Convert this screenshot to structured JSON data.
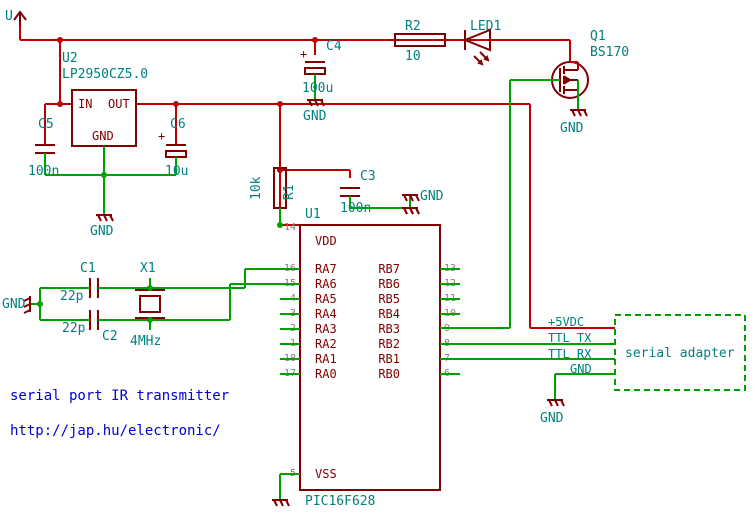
{
  "title": "serial port IR transmitter",
  "url": "http://jap.hu/electronic/",
  "power_label": "U",
  "regulator": {
    "ref": "U2",
    "part": "LP2950CZ5.0",
    "in": "IN",
    "out": "OUT",
    "gnd": "GND"
  },
  "caps": {
    "C1": {
      "ref": "C1",
      "val": "22p"
    },
    "C2": {
      "ref": "C2",
      "val": "22p"
    },
    "C3": {
      "ref": "C3",
      "val": "100n"
    },
    "C4": {
      "ref": "C4",
      "val": "100u"
    },
    "C5": {
      "ref": "C5",
      "val": "100n"
    },
    "C6": {
      "ref": "C6",
      "val": "10u"
    }
  },
  "res": {
    "R1": {
      "ref": "R1",
      "val": "10k"
    },
    "R2": {
      "ref": "R2",
      "val": "10"
    }
  },
  "crystal": {
    "ref": "X1",
    "val": "4MHz"
  },
  "led": {
    "ref": "LED1"
  },
  "mosfet": {
    "ref": "Q1",
    "part": "BS170"
  },
  "mcu": {
    "ref": "U1",
    "part": "PIC16F628",
    "vdd": "VDD",
    "vss": "VSS",
    "left_pins": [
      [
        "14",
        "VDD"
      ],
      [
        "16",
        "RA7"
      ],
      [
        "15",
        "RA6"
      ],
      [
        "4",
        "RA5"
      ],
      [
        "3",
        "RA4"
      ],
      [
        "2",
        "RA3"
      ],
      [
        "1",
        "RA2"
      ],
      [
        "18",
        "RA1"
      ],
      [
        "17",
        "RA0"
      ],
      [
        "5",
        "VSS"
      ]
    ],
    "right_pins": [
      [
        "13",
        "RB7"
      ],
      [
        "12",
        "RB6"
      ],
      [
        "11",
        "RB5"
      ],
      [
        "10",
        "RB4"
      ],
      [
        "9",
        "RB3"
      ],
      [
        "8",
        "RB2"
      ],
      [
        "7",
        "RB1"
      ],
      [
        "6",
        "RB0"
      ]
    ]
  },
  "serial": {
    "label": "serial adapter",
    "v5": "+5VDC",
    "tx": "TTL TX",
    "rx": "TTL RX",
    "gnd": "GND"
  },
  "gnd": "GND"
}
